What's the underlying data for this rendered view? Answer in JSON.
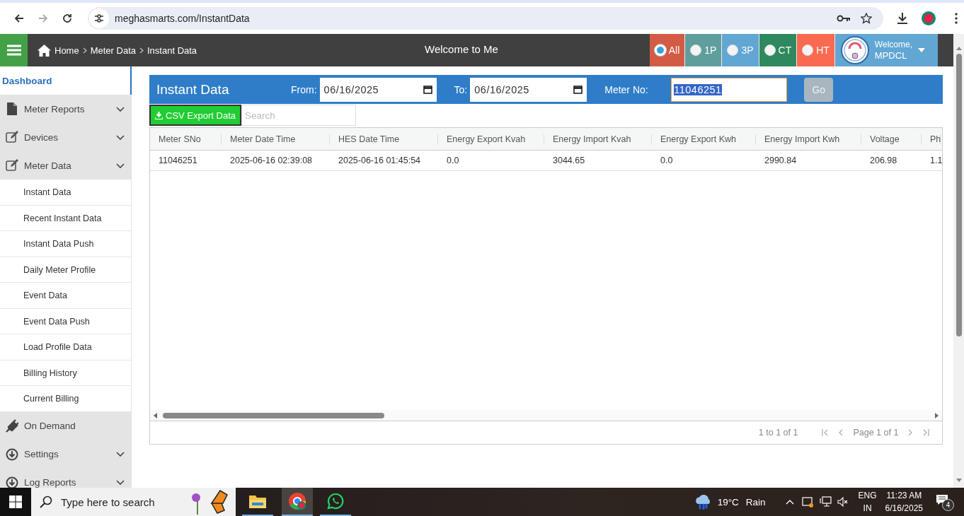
{
  "browser": {
    "url": "meghasmarts.com/InstantData"
  },
  "header": {
    "breadcrumb": [
      "Home",
      "Meter Data",
      "Instant Data"
    ],
    "title": "Welcome to Me",
    "filters": [
      {
        "label": "All",
        "selected": true,
        "color": "#d35b45"
      },
      {
        "label": "1P",
        "selected": false,
        "color": "#5f9e9d"
      },
      {
        "label": "3P",
        "selected": false,
        "color": "#62a6d3"
      },
      {
        "label": "CT",
        "selected": false,
        "color": "#2e8a5e"
      },
      {
        "label": "HT",
        "selected": false,
        "color": "#f96a51"
      }
    ],
    "user": {
      "greeting": "Welcome,",
      "name": "MPDCL"
    }
  },
  "sidebar": {
    "items": [
      {
        "label": "Dashboard",
        "kind": "link",
        "selected": true
      },
      {
        "label": "Meter Reports",
        "kind": "menu",
        "selected": false
      },
      {
        "label": "Devices",
        "kind": "menu",
        "selected": false
      },
      {
        "label": "Meter Data",
        "kind": "menu",
        "selected": false,
        "children": [
          {
            "label": "Instant Data",
            "selected": false
          },
          {
            "label": "Recent Instant Data",
            "selected": false
          },
          {
            "label": "Instant Data Push",
            "selected": false
          },
          {
            "label": "Daily Meter Profile",
            "selected": false
          },
          {
            "label": "Event Data",
            "selected": false
          },
          {
            "label": "Event Data Push",
            "selected": false
          },
          {
            "label": "Load Profile Data",
            "selected": false
          },
          {
            "label": "Billing History",
            "selected": false
          },
          {
            "label": "Current Billing",
            "selected": false
          }
        ]
      },
      {
        "label": "On Demand",
        "kind": "link",
        "selected": false
      },
      {
        "label": "Settings",
        "kind": "menu",
        "selected": false
      },
      {
        "label": "Log Reports",
        "kind": "menu",
        "selected": false
      }
    ]
  },
  "panel": {
    "title": "Instant Data",
    "from_label": "From:",
    "from_value": "06/16/2025",
    "to_label": "To:",
    "to_value": "06/16/2025",
    "meter_label": "Meter No:",
    "meter_value": "11046251",
    "go_button": {
      "label": "Go",
      "disabled": true
    },
    "export_button": "CSV Export Data",
    "search": {
      "placeholder": "Search"
    },
    "table": {
      "columns": [
        "Meter SNo",
        "Meter Date Time",
        "HES Date Time",
        "Energy Export Kvah",
        "Energy Import Kvah",
        "Energy Export Kwh",
        "Energy Import Kwh",
        "Voltage",
        "Ph"
      ],
      "rows": [
        [
          "11046251",
          "2025-06-16 02:39:08",
          "2025-06-16 01:45:54",
          "0.0",
          "3044.65",
          "0.0",
          "2990.84",
          "206.98",
          "1.1"
        ]
      ]
    },
    "pagination": {
      "summary": "1 to 1 of 1",
      "page": "Page 1 of 1"
    }
  },
  "taskbar": {
    "search": {
      "placeholder": "Type here to search"
    },
    "temperature": "19°C",
    "weather": "Rain",
    "language": "ENG",
    "region": "IN",
    "time": "11:23 AM",
    "date": "6/16/2025",
    "notifications": "4"
  }
}
